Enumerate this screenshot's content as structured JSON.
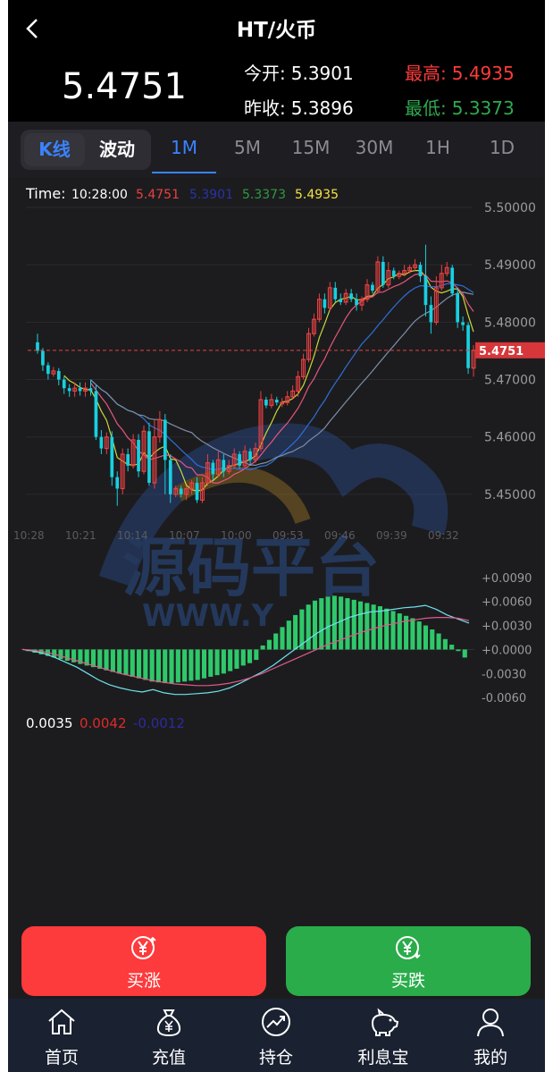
{
  "header": {
    "title": "HT/火币"
  },
  "price": {
    "last": "5.4751",
    "open_label": "今开:",
    "open": "5.3901",
    "prev_close_label": "昨收:",
    "prev_close": "5.3896",
    "high_label": "最高:",
    "high": "5.4935",
    "low_label": "最低:",
    "low": "5.3373"
  },
  "tabs": {
    "modes": [
      "K线",
      "波动"
    ],
    "periods": [
      "1M",
      "5M",
      "15M",
      "30M",
      "1H",
      "1D"
    ],
    "active_period": "1M"
  },
  "chart_data": {
    "type": "candlestick",
    "info_line": {
      "label": "Time:",
      "time": "10:28:00",
      "values": [
        "5.4751",
        "5.3901",
        "5.3373",
        "5.4935"
      ],
      "colors": [
        "#e84142",
        "#2933a8",
        "#2e9a40",
        "#f5e342"
      ]
    },
    "y_ticks": [
      "5.50000",
      "5.49000",
      "5.48000",
      "5.47000",
      "5.46000",
      "5.45000"
    ],
    "ylim": [
      5.445,
      5.5
    ],
    "last_price_tag": "5.4751",
    "x_ticks": [
      "10:28",
      "10:21",
      "10:14",
      "10:07",
      "10:00",
      "09:53",
      "09:46",
      "09:39",
      "09:32"
    ],
    "candles": [
      [
        5.4765,
        5.475,
        5.478,
        5.4745
      ],
      [
        5.475,
        5.4725,
        5.4755,
        5.4715
      ],
      [
        5.4725,
        5.471,
        5.473,
        5.47
      ],
      [
        5.471,
        5.4715,
        5.4722,
        5.4705
      ],
      [
        5.4715,
        5.47,
        5.472,
        5.469
      ],
      [
        5.47,
        5.4685,
        5.4705,
        5.4675
      ],
      [
        5.4685,
        5.468,
        5.4692,
        5.467
      ],
      [
        5.468,
        5.4685,
        5.4695,
        5.467
      ],
      [
        5.4685,
        5.468,
        5.4695,
        5.4672
      ],
      [
        5.468,
        5.4685,
        5.4695,
        5.467
      ],
      [
        5.4685,
        5.468,
        5.47,
        5.4672
      ],
      [
        5.468,
        5.46,
        5.469,
        5.4595
      ],
      [
        5.46,
        5.458,
        5.4612,
        5.457
      ],
      [
        5.458,
        5.46,
        5.4608,
        5.457
      ],
      [
        5.46,
        5.453,
        5.461,
        5.4515
      ],
      [
        5.453,
        5.451,
        5.454,
        5.448
      ],
      [
        5.451,
        5.457,
        5.458,
        5.45
      ],
      [
        5.457,
        5.455,
        5.458,
        5.454
      ],
      [
        5.455,
        5.4595,
        5.4605,
        5.4545
      ],
      [
        5.4595,
        5.454,
        5.4605,
        5.453
      ],
      [
        5.454,
        5.461,
        5.462,
        5.4535
      ],
      [
        5.461,
        5.452,
        5.4625,
        5.4515
      ],
      [
        5.452,
        5.46,
        5.463,
        5.451
      ],
      [
        5.46,
        5.463,
        5.4645,
        5.459
      ],
      [
        5.463,
        5.456,
        5.464,
        5.45
      ],
      [
        5.456,
        5.45,
        5.457,
        5.4485
      ],
      [
        5.45,
        5.451,
        5.4515,
        5.4495
      ],
      [
        5.451,
        5.45,
        5.4515,
        5.4495
      ],
      [
        5.45,
        5.451,
        5.4515,
        5.449
      ],
      [
        5.451,
        5.452,
        5.4525,
        5.45
      ],
      [
        5.452,
        5.449,
        5.453,
        5.4485
      ],
      [
        5.449,
        5.452,
        5.453,
        5.4485
      ],
      [
        5.452,
        5.4555,
        5.457,
        5.4515
      ],
      [
        5.4555,
        5.4535,
        5.456,
        5.4525
      ],
      [
        5.4535,
        5.456,
        5.4575,
        5.453
      ],
      [
        5.456,
        5.454,
        5.457,
        5.453
      ],
      [
        5.454,
        5.455,
        5.456,
        5.4535
      ],
      [
        5.455,
        5.457,
        5.458,
        5.4545
      ],
      [
        5.457,
        5.455,
        5.4575,
        5.4545
      ],
      [
        5.455,
        5.4575,
        5.4585,
        5.4545
      ],
      [
        5.4575,
        5.456,
        5.458,
        5.455
      ],
      [
        5.456,
        5.458,
        5.459,
        5.4555
      ],
      [
        5.458,
        5.4665,
        5.468,
        5.4575
      ],
      [
        5.4665,
        5.4655,
        5.467,
        5.465
      ],
      [
        5.4655,
        5.4665,
        5.4675,
        5.465
      ],
      [
        5.4665,
        5.466,
        5.467,
        5.4655
      ],
      [
        5.466,
        5.466,
        5.4668,
        5.4652
      ],
      [
        5.466,
        5.467,
        5.468,
        5.4655
      ],
      [
        5.467,
        5.468,
        5.469,
        5.4665
      ],
      [
        5.468,
        5.4705,
        5.4715,
        5.467
      ],
      [
        5.4705,
        5.4735,
        5.4745,
        5.47
      ],
      [
        5.4735,
        5.478,
        5.479,
        5.473
      ],
      [
        5.478,
        5.4805,
        5.4815,
        5.4775
      ],
      [
        5.4805,
        5.484,
        5.485,
        5.48
      ],
      [
        5.484,
        5.4825,
        5.485,
        5.4815
      ],
      [
        5.4825,
        5.486,
        5.487,
        5.482
      ],
      [
        5.486,
        5.484,
        5.487,
        5.4835
      ],
      [
        5.484,
        5.4835,
        5.485,
        5.483
      ],
      [
        5.4835,
        5.485,
        5.4858,
        5.483
      ],
      [
        5.485,
        5.484,
        5.4858,
        5.4835
      ],
      [
        5.484,
        5.483,
        5.485,
        5.482
      ],
      [
        5.483,
        5.484,
        5.4845,
        5.482
      ],
      [
        5.484,
        5.4865,
        5.4875,
        5.4835
      ],
      [
        5.4865,
        5.4855,
        5.487,
        5.485
      ],
      [
        5.4855,
        5.4905,
        5.4915,
        5.485
      ],
      [
        5.4905,
        5.4865,
        5.4915,
        5.486
      ],
      [
        5.4865,
        5.489,
        5.4905,
        5.486
      ],
      [
        5.489,
        5.488,
        5.4895,
        5.4875
      ],
      [
        5.488,
        5.4885,
        5.489,
        5.4875
      ],
      [
        5.4885,
        5.489,
        5.49,
        5.488
      ],
      [
        5.489,
        5.4895,
        5.49,
        5.4885
      ],
      [
        5.4895,
        5.49,
        5.491,
        5.489
      ],
      [
        5.49,
        5.488,
        5.4905,
        5.487
      ],
      [
        5.488,
        5.483,
        5.4935,
        5.481
      ],
      [
        5.483,
        5.48,
        5.4845,
        5.478
      ],
      [
        5.48,
        5.486,
        5.488,
        5.4795
      ],
      [
        5.486,
        5.4885,
        5.49,
        5.4855
      ],
      [
        5.4885,
        5.4895,
        5.4905,
        5.488
      ],
      [
        5.4895,
        5.485,
        5.49,
        5.4845
      ],
      [
        5.485,
        5.48,
        5.486,
        5.479
      ],
      [
        5.48,
        5.4795,
        5.481,
        5.4785
      ],
      [
        5.4795,
        5.472,
        5.48,
        5.471
      ],
      [
        5.472,
        5.4751,
        5.476,
        5.4705
      ]
    ],
    "macd_ticks": [
      "+0.0090",
      "+0.0060",
      "+0.0030",
      "+0.0000",
      "-0.0030",
      "-0.0060"
    ],
    "macd_ylim": [
      -0.0072,
      0.0102
    ],
    "macd_hist": [
      -0.0002,
      -0.0004,
      -0.0006,
      -0.0008,
      -0.001,
      -0.0012,
      -0.0014,
      -0.0016,
      -0.0018,
      -0.002,
      -0.0022,
      -0.0024,
      -0.0026,
      -0.0028,
      -0.003,
      -0.0032,
      -0.0034,
      -0.0036,
      -0.0038,
      -0.004,
      -0.0041,
      -0.0042,
      -0.0042,
      -0.0041,
      -0.004,
      -0.0039,
      -0.0038,
      -0.0036,
      -0.0034,
      -0.0032,
      -0.003,
      -0.0027,
      -0.0024,
      -0.002,
      -0.0017,
      -0.0013,
      0.0005,
      0.0012,
      0.002,
      0.0028,
      0.0036,
      0.0043,
      0.005,
      0.0056,
      0.0061,
      0.0064,
      0.0066,
      0.0067,
      0.0066,
      0.0064,
      0.0062,
      0.006,
      0.0058,
      0.0056,
      0.0054,
      0.0051,
      0.0048,
      0.0045,
      0.0042,
      0.0039,
      0.0035,
      0.003,
      0.0025,
      0.002,
      0.0013,
      0.0006,
      -0.0002,
      -0.001
    ],
    "macd_dif": [
      0.0,
      -0.0002,
      -0.0005,
      -0.001,
      -0.0016,
      -0.0022,
      -0.003,
      -0.0038,
      -0.0044,
      -0.0048,
      -0.0051,
      -0.0053,
      -0.005,
      -0.0054,
      -0.0056,
      -0.0056,
      -0.0055,
      -0.0054,
      -0.0052,
      -0.0048,
      -0.0042,
      -0.0035,
      -0.0028,
      -0.002,
      -0.001,
      0.0,
      0.001,
      0.002,
      0.0028,
      0.0034,
      0.004,
      0.0044,
      0.0047,
      0.0048,
      0.005,
      0.0052,
      0.0053,
      0.0055,
      0.005,
      0.0043,
      0.0038,
      0.0033
    ],
    "macd_dea": [
      0.0,
      -0.0001,
      -0.0003,
      -0.0006,
      -0.001,
      -0.0014,
      -0.0018,
      -0.0022,
      -0.0026,
      -0.003,
      -0.0033,
      -0.0036,
      -0.0039,
      -0.0041,
      -0.0043,
      -0.0044,
      -0.0045,
      -0.0045,
      -0.0044,
      -0.0042,
      -0.0039,
      -0.0035,
      -0.003,
      -0.0024,
      -0.0018,
      -0.0012,
      -0.0006,
      0.0,
      0.0006,
      0.0011,
      0.0016,
      0.0021,
      0.0025,
      0.0029,
      0.0032,
      0.0035,
      0.0037,
      0.0039,
      0.004,
      0.004,
      0.0039,
      0.0036
    ],
    "macd_values": [
      {
        "text": "0.0035",
        "color": "#ffffff"
      },
      {
        "text": "0.0042",
        "color": "#e02a2a"
      },
      {
        "text": "-0.0012",
        "color": "#2d2aa0"
      }
    ],
    "colors": {
      "up": "#e84142",
      "down": "#18d0e0",
      "ma5": "#c9d93a",
      "ma10": "#e8557d",
      "ma30": "#2f6fd8",
      "ma60": "#7e8fa8",
      "hist": "#2fc86b"
    }
  },
  "actions": {
    "buy_up": "买涨",
    "buy_down": "买跌",
    "buy_up_icon": "yen-up-icon",
    "buy_down_icon": "yen-down-icon"
  },
  "watermark": {
    "text": "源码平台",
    "sub": "WWW.Y"
  },
  "nav": [
    {
      "label": "首页",
      "icon": "home-icon"
    },
    {
      "label": "充值",
      "icon": "money-bag-icon"
    },
    {
      "label": "持仓",
      "icon": "trend-chart-icon"
    },
    {
      "label": "利息宝",
      "icon": "piggy-bank-icon"
    },
    {
      "label": "我的",
      "icon": "user-icon"
    }
  ]
}
